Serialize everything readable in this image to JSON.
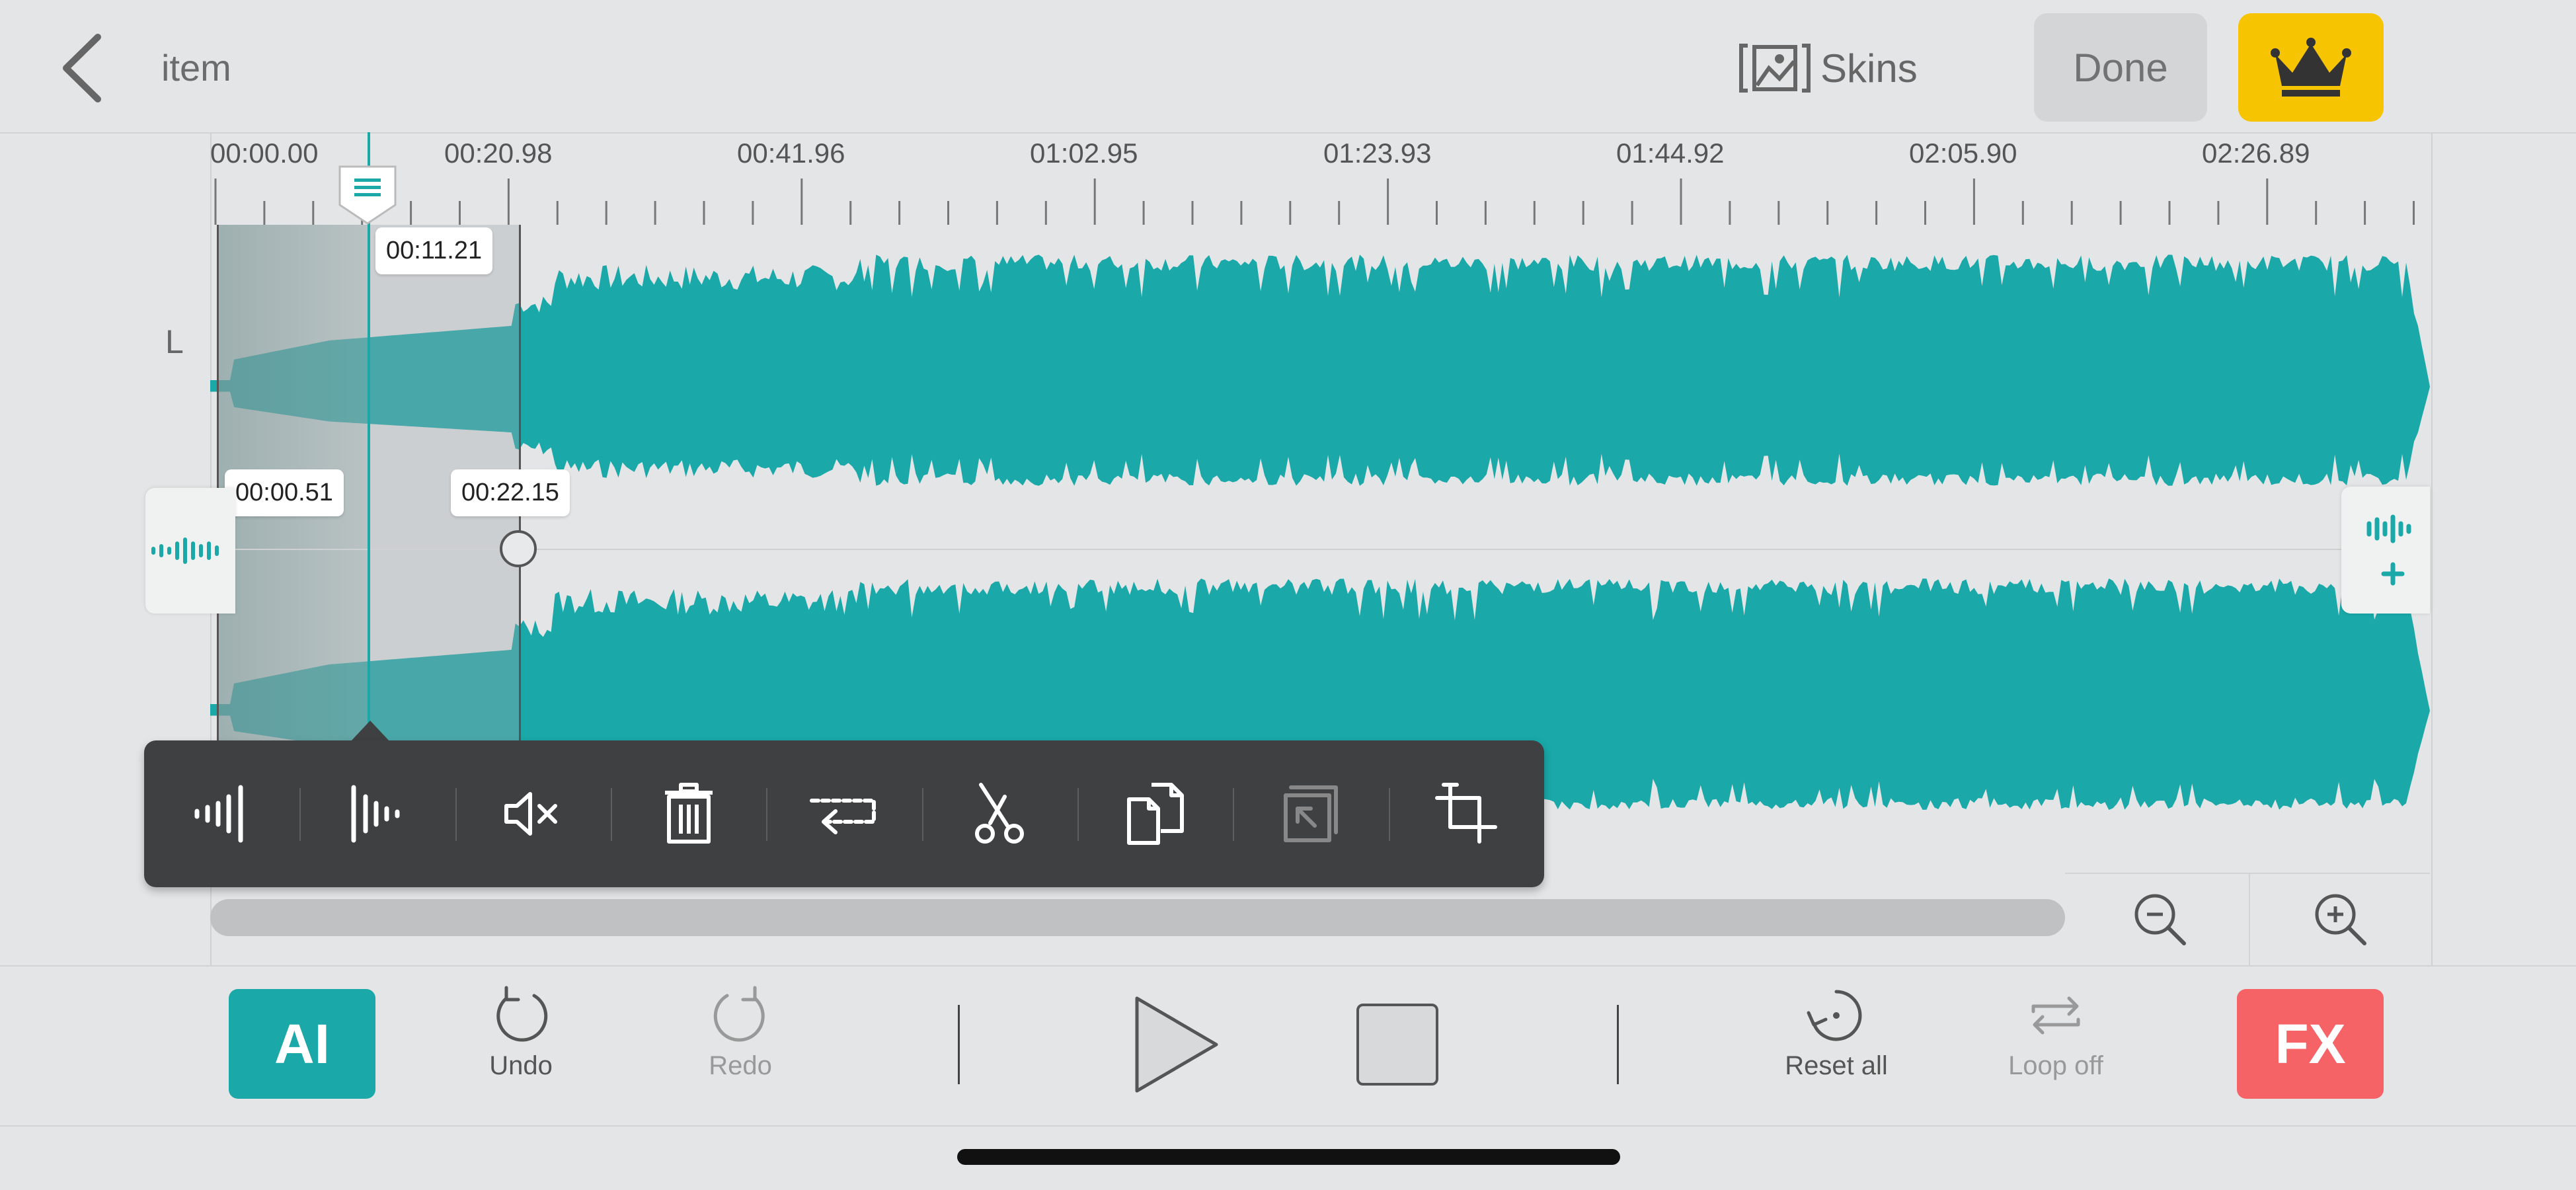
{
  "header": {
    "title": "item",
    "skins_label": "Skins",
    "done_label": "Done"
  },
  "timeline": {
    "ticks": [
      "00:00.00",
      "00:20.98",
      "00:41.96",
      "01:02.95",
      "01:23.93",
      "01:44.92",
      "02:05.90",
      "02:26.89"
    ],
    "channel_label": "L",
    "playhead_time": "00:11.21",
    "selection_start": "00:00.51",
    "selection_end": "00:22.15"
  },
  "toolbar": {
    "tools": [
      "fade-in",
      "fade-out",
      "mute",
      "delete",
      "loop",
      "cut",
      "copy",
      "paste",
      "crop"
    ]
  },
  "bottom": {
    "ai_label": "AI",
    "undo_label": "Undo",
    "redo_label": "Redo",
    "reset_label": "Reset all",
    "loop_label": "Loop off",
    "fx_label": "FX"
  },
  "colors": {
    "wave": "#1aa8a8",
    "accent_premium": "#f6c400",
    "fx": "#f56367"
  }
}
